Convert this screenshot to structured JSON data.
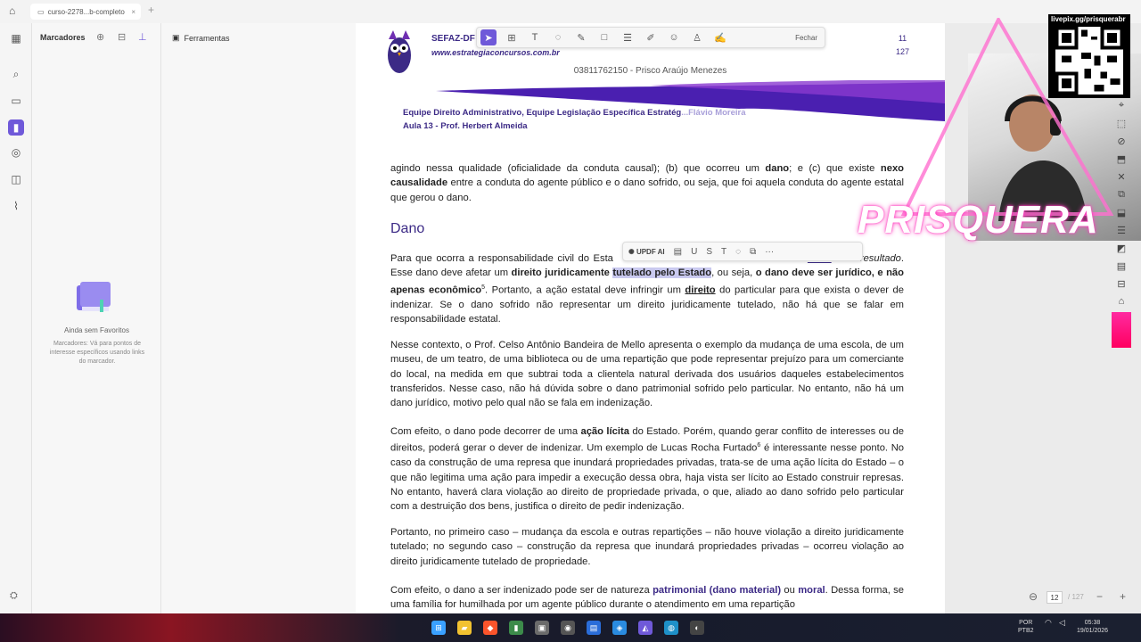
{
  "window": {
    "tab_title": "curso-2278...b-completo",
    "tab_close": "×",
    "new_tab": "+",
    "home": "⌂",
    "controls": [
      "—",
      "☐",
      "✕"
    ]
  },
  "left_rail": {
    "items": [
      {
        "name": "thumbnails-icon",
        "glyph": "▦"
      },
      {
        "name": "search-icon",
        "glyph": "⌕"
      },
      {
        "name": "page-icon",
        "glyph": "▭"
      },
      {
        "name": "bookmark-icon",
        "glyph": "▮"
      },
      {
        "name": "comment-icon",
        "glyph": "◎"
      },
      {
        "name": "layers-icon",
        "glyph": "◫"
      },
      {
        "name": "attachment-icon",
        "glyph": "⌇"
      }
    ],
    "bottom": "⛭"
  },
  "bookmarks_panel": {
    "title": "Marcadores",
    "empty_title": "Ainda sem Favoritos",
    "empty_desc": "Marcadores: Vá para pontos de interesse específicos usando links do marcador.",
    "pager_prev": "‹",
    "pager_more": "···",
    "pager_next": "›"
  },
  "tools_panel": {
    "label": "Ferramentas",
    "icon": "▣"
  },
  "annotation_toolbar": {
    "tools": [
      {
        "name": "select-tool-icon",
        "glyph": "➤",
        "active": true
      },
      {
        "name": "frame-tool-icon",
        "glyph": "⊞"
      },
      {
        "name": "text-tool-icon",
        "glyph": "T"
      },
      {
        "name": "comment-tool-icon",
        "glyph": "◌"
      },
      {
        "name": "pen-tool-icon",
        "glyph": "✎"
      },
      {
        "name": "rect-tool-icon",
        "glyph": "□"
      },
      {
        "name": "list-tool-icon",
        "glyph": "☰"
      },
      {
        "name": "pencil-tool-icon",
        "glyph": "✐"
      },
      {
        "name": "sticker-tool-icon",
        "glyph": "☺"
      },
      {
        "name": "stamp-tool-icon",
        "glyph": "♙"
      },
      {
        "name": "signature-tool-icon",
        "glyph": "✍"
      }
    ],
    "close_label": "Fechar"
  },
  "selection_toolbar": {
    "ai_label": "UPDF AI",
    "tools": [
      {
        "name": "highlight-icon",
        "glyph": "▤"
      },
      {
        "name": "underline-icon",
        "glyph": "U"
      },
      {
        "name": "strikethrough-icon",
        "glyph": "S"
      },
      {
        "name": "text-icon",
        "glyph": "T"
      },
      {
        "name": "comment-icon",
        "glyph": "◌"
      },
      {
        "name": "copy-icon",
        "glyph": "⧉"
      },
      {
        "name": "more-icon",
        "glyph": "···"
      }
    ]
  },
  "document": {
    "header": {
      "sefaz": "SEFAZ-DF",
      "site": "www.estrategiaconcursos.com.br",
      "page_current": "11",
      "page_total": "127",
      "cpf_line": "03811762150 - Prisco Araújo Menezes"
    },
    "team_line1": "Equipe Direito Administrativo, Equipe Legislação Específica Estratég",
    "team_line1_faded": "...Flávio Moreira",
    "team_line2": "Aula 13 - Prof. Herbert Almeida",
    "p0": {
      "a": "agindo nessa qualidade (oficialidade da conduta causal); (b) que ocorreu um ",
      "b": "dano",
      "c": "; e (c) que existe ",
      "d": "nexo",
      "e": "causalidade",
      "f": " entre a conduta do agente público e o dano sofrido, ou seja, que foi aquela conduta do agente estatal que gerou o dano."
    },
    "heading_dano": "Dano",
    "p1": {
      "a": "Para que ocorra a responsabilidade civil do Esta",
      "b": "dano",
      "c": " – ou ",
      "d": "resultado",
      "e": ". Esse dano deve afetar um ",
      "f": "direito juridicamente ",
      "g": "tutelado pelo Estado",
      "h": ", ou seja, ",
      "i": "o dano deve ser jurídico, e não apenas econômico",
      "j": "5",
      "k": ". Portanto, a ação estatal deve infringir um ",
      "l": "direito",
      "m": " do particular para que exista o dever de indenizar. Se o dano sofrido não representar um direito juridicamente tutelado, não há que se falar em responsabilidade estatal."
    },
    "p2": "Nesse contexto, o Prof. Celso Antônio Bandeira de Mello apresenta o exemplo da mudança de uma escola, de um museu, de um teatro, de uma biblioteca ou de uma repartição que pode representar prejuízo para um comerciante do local, na medida em que subtrai toda a clientela natural derivada dos usuários daqueles estabelecimentos transferidos. Nesse caso, não há dúvida sobre o dano patrimonial sofrido pelo particular. No entanto, não há um dano jurídico, motivo pelo qual não se fala em indenização.",
    "p3": {
      "a": "Com efeito, o dano pode decorrer de uma ",
      "b": "ação lícita",
      "c": " do Estado. Porém, quando gerar conflito de interesses ou de direitos, poderá gerar o dever de indenizar. Um exemplo de Lucas Rocha Furtado",
      "d": "6",
      "e": " é interessante nesse ponto. No caso da construção de uma represa que inundará propriedades privadas, trata-se de uma ação lícita do Estado – o que não legitima uma ação para impedir a execução dessa obra, haja vista ser lícito ao Estado construir represas. No entanto, haverá clara violação ao direito de propriedade privada, o que, aliado ao dano sofrido pelo particular com a destruição dos bens, justifica o direito de pedir indenização."
    },
    "p4": "Portanto, no primeiro caso – mudança da escola e outras repartições – não houve violação a direito juridicamente tutelado; no segundo caso – construção da represa que inundará propriedades privadas – ocorreu violação ao direito juridicamente tutelado de propriedade.",
    "p5": {
      "a": "Com efeito, o dano a ser indenizado pode ser de natureza ",
      "b": "patrimonial (dano material)",
      "c": " ou ",
      "d": "moral",
      "e": ". Dessa forma, se uma família for humilhada por um agente público durante o atendimento em uma repartição"
    }
  },
  "right_tools": [
    "⌖",
    "⬚",
    "⊘",
    "⬒",
    "✕",
    "⧉",
    "⬓",
    "☰",
    "◩",
    "▤",
    "⊟",
    "⌂",
    "■"
  ],
  "overlay": {
    "livepix": "livepix.gg/prisquerabr",
    "streamer_name": "PRISQUERA"
  },
  "footer": {
    "page_input": "12",
    "page_total": "/ 127",
    "zoom_out": "−",
    "zoom_in": "+"
  },
  "taskbar": {
    "apps": [
      {
        "name": "windows-start-icon",
        "glyph": "⊞",
        "color": "#3aa0ff"
      },
      {
        "name": "file-explorer-icon",
        "glyph": "▰",
        "color": "#f2c230"
      },
      {
        "name": "brave-icon",
        "glyph": "◆",
        "color": "#fb542b"
      },
      {
        "name": "app-icon-1",
        "glyph": "▮",
        "color": "#3c8b4a"
      },
      {
        "name": "app-icon-2",
        "glyph": "▣",
        "color": "#6b6b6b"
      },
      {
        "name": "chrome-icon",
        "glyph": "◉",
        "color": "#555555"
      },
      {
        "name": "app-icon-3",
        "glyph": "▤",
        "color": "#2a6dd9"
      },
      {
        "name": "app-icon-4",
        "glyph": "◈",
        "color": "#2a8be0"
      },
      {
        "name": "updf-icon",
        "glyph": "◭",
        "color": "#6f59d9"
      },
      {
        "name": "edge-icon",
        "glyph": "◍",
        "color": "#1e90c8"
      },
      {
        "name": "app-icon-5",
        "glyph": "◐",
        "color": "#444444"
      }
    ],
    "lang_top": "POR",
    "lang_bottom": "PTB2",
    "time": "05:38",
    "date": "19/01/2026"
  },
  "colors": {
    "accent": "#6f59d9",
    "brand_purple": "#3c2a86",
    "highlight": "#c9c9ef",
    "overlay_pink": "#ff3ebf"
  }
}
